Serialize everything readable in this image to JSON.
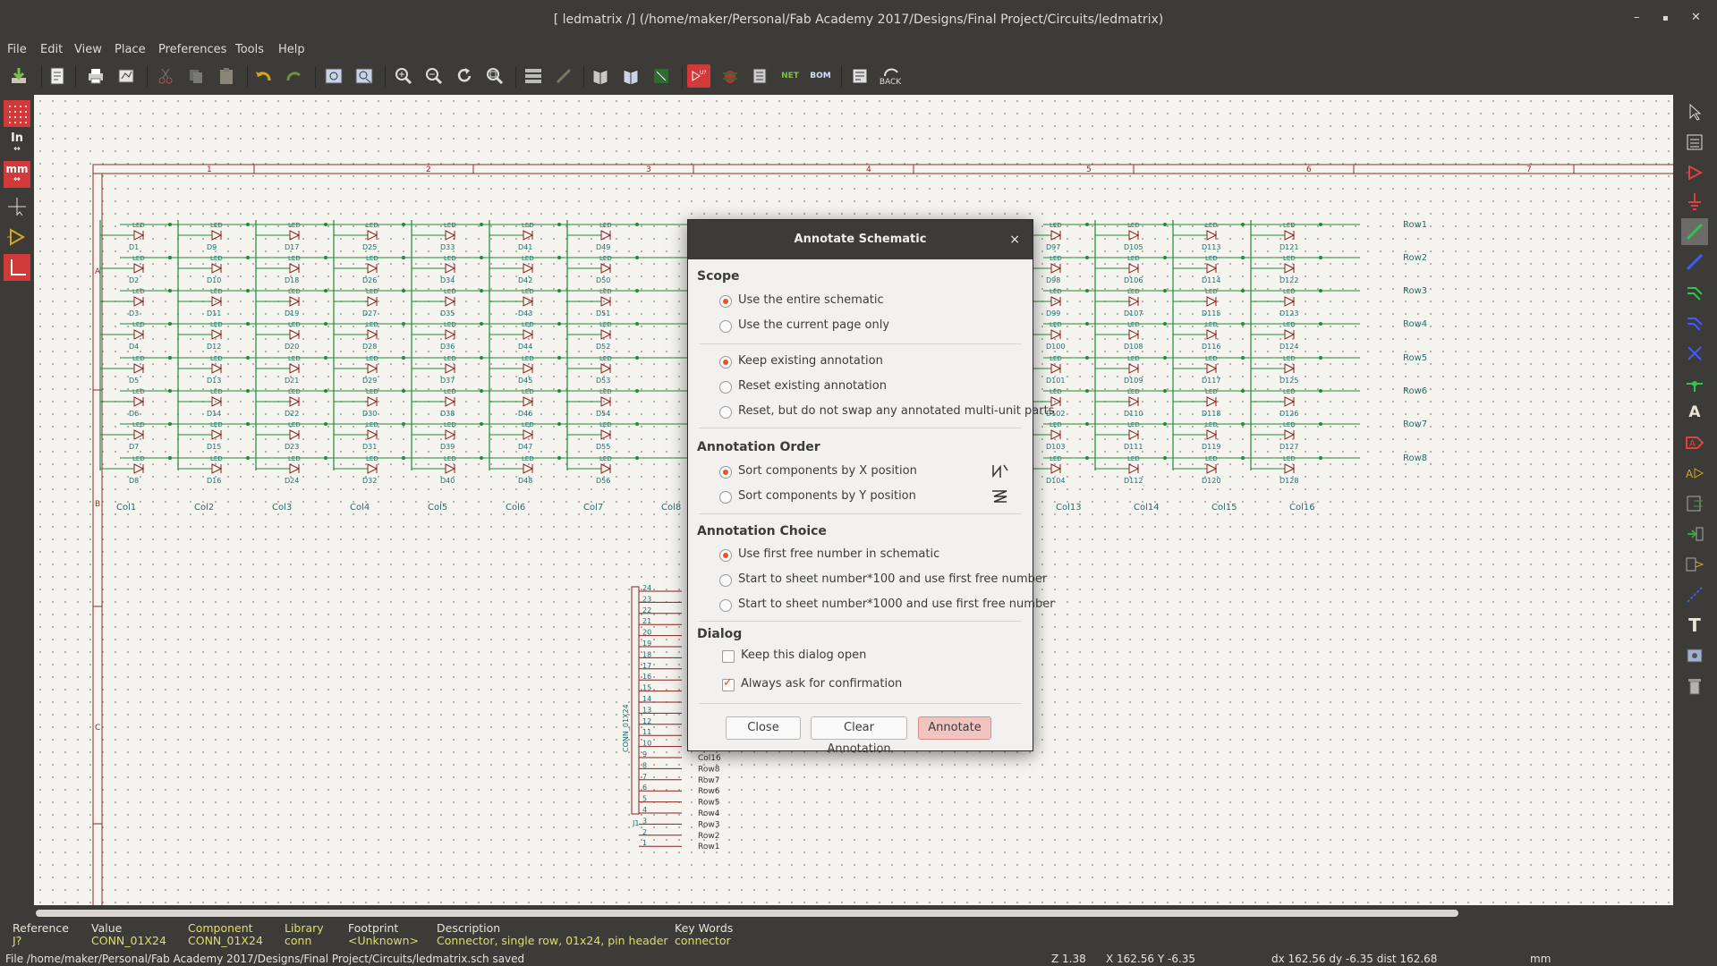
{
  "window": {
    "title": "[ ledmatrix /] (/home/maker/Personal/Fab Academy 2017/Designs/Final Project/Circuits/ledmatrix)",
    "minimize": "–",
    "maximize": "▪",
    "close": "✕"
  },
  "menu": [
    "File",
    "Edit",
    "View",
    "Place",
    "Preferences",
    "Tools",
    "Help"
  ],
  "toolbar": {
    "net_label": "NET",
    "bom_label": "BOM",
    "back_label": "BACK",
    "icons": [
      "save-icon",
      "page-settings-icon",
      "print-icon",
      "plot-icon",
      "cut-icon",
      "copy-icon",
      "paste-icon",
      "undo-icon",
      "redo-icon",
      "find-icon",
      "find-replace-icon",
      "zoom-in-icon",
      "zoom-out-icon",
      "redraw-icon",
      "zoom-fit-icon",
      "hierarchy-icon",
      "leave-sheet-icon",
      "library-editor-icon",
      "library-browser-icon",
      "module-editor-icon",
      "annotate-icon",
      "erc-icon",
      "cvpcb-icon",
      "netlist-icon",
      "bom-icon",
      "pcbnew-icon",
      "back-import-icon"
    ]
  },
  "left_toolbar": {
    "units_in": "In",
    "units_mm": "mm"
  },
  "schematic": {
    "zone_numbers": [
      "1",
      "2",
      "3",
      "4",
      "5",
      "6",
      "7"
    ],
    "zone_letters": [
      "A",
      "B",
      "C"
    ],
    "row_labels": [
      "Row1",
      "Row2",
      "Row3",
      "Row4",
      "Row5",
      "Row6",
      "Row7",
      "Row8"
    ],
    "col_labels_left": [
      "Col1",
      "Col2",
      "Col3",
      "Col4",
      "Col5",
      "Col6",
      "Col7",
      "Col8"
    ],
    "col_labels_right": [
      "Col13",
      "Col14",
      "Col15",
      "Col16"
    ],
    "led_columns_left": [
      [
        "D1",
        "D2",
        "D3",
        "D4",
        "D5",
        "D6",
        "D7",
        "D8"
      ],
      [
        "D9",
        "D10",
        "D11",
        "D12",
        "D13",
        "D14",
        "D15",
        "D16"
      ],
      [
        "D17",
        "D18",
        "D19",
        "D20",
        "D21",
        "D22",
        "D23",
        "D24"
      ],
      [
        "D25",
        "D26",
        "D27",
        "D28",
        "D29",
        "D30",
        "D31",
        "D32"
      ],
      [
        "D33",
        "D34",
        "D35",
        "D36",
        "D37",
        "D38",
        "D39",
        "D40"
      ],
      [
        "D41",
        "D42",
        "D43",
        "D44",
        "D45",
        "D46",
        "D47",
        "D48"
      ],
      [
        "D49",
        "D50",
        "D51",
        "D52",
        "D53",
        "D54",
        "D55",
        "D56"
      ]
    ],
    "led_columns_right": [
      [
        "D97",
        "D98",
        "D99",
        "D100",
        "D101",
        "D102",
        "D103",
        "D104"
      ],
      [
        "D105",
        "D106",
        "D107",
        "D108",
        "D109",
        "D110",
        "D111",
        "D112"
      ],
      [
        "D113",
        "D114",
        "D115",
        "D116",
        "D117",
        "D118",
        "D119",
        "D120"
      ],
      [
        "D121",
        "D122",
        "D123",
        "D124",
        "D125",
        "D126",
        "D127",
        "D128"
      ]
    ],
    "led_value": "LED",
    "connector_ref": "J1",
    "connector_value": "CONN_01X24",
    "pin_numbers": [
      "24",
      "23",
      "22",
      "21",
      "20",
      "19",
      "18",
      "17",
      "16",
      "15",
      "14",
      "13",
      "12",
      "11",
      "10",
      "9",
      "8",
      "7",
      "6",
      "5",
      "4",
      "3",
      "2",
      "1"
    ],
    "pin_labels": [
      "Col16",
      "Row8",
      "Row7",
      "Row6",
      "Row5",
      "Row4",
      "Row3",
      "Row2",
      "Row1"
    ]
  },
  "dialog": {
    "title": "Annotate Schematic",
    "close_glyph": "×",
    "scope_heading": "Scope",
    "scope_options": [
      "Use the entire schematic",
      "Use the current page only"
    ],
    "existing_options": [
      "Keep existing annotation",
      "Reset existing annotation",
      "Reset, but do not swap any annotated multi-unit parts"
    ],
    "order_heading": "Annotation Order",
    "order_options": [
      "Sort components by X position",
      "Sort components by Y position"
    ],
    "choice_heading": "Annotation Choice",
    "choice_options": [
      "Use first free number in schematic",
      "Start to  sheet number*100 and use first free number",
      "Start to  sheet number*1000 and use first free number"
    ],
    "dialog_heading": "Dialog",
    "dialog_options": [
      "Keep this dialog open",
      "Always ask for confirmation"
    ],
    "buttons": {
      "close": "Close",
      "clear": "Clear Annotation",
      "annotate": "Annotate"
    }
  },
  "message_panel": {
    "reference": {
      "label": "Reference",
      "value": "J?"
    },
    "value": {
      "label": "Value",
      "value": "CONN_01X24"
    },
    "component": {
      "label": "Component",
      "value": "CONN_01X24"
    },
    "library": {
      "label": "Library",
      "value": "conn"
    },
    "footprint": {
      "label": "Footprint",
      "value": "<Unknown>"
    },
    "description": {
      "label": "Description",
      "value": "Connector, single row, 01x24, pin header"
    },
    "keywords": {
      "label": "Key Words",
      "value": "connector"
    }
  },
  "status": {
    "message": "File /home/maker/Personal/Fab Academy 2017/Designs/Final Project/Circuits/ledmatrix.sch saved",
    "zoom": "Z 1.38",
    "coords": "X 162.56  Y -6.35",
    "delta": "dx 162.56  dy -6.35  dist 162.68",
    "units": "mm"
  },
  "colors": {
    "sheet_border": "#8c2b2b",
    "wire": "#1f8a3a",
    "component": "#8a1f1f",
    "text": "#1e6f6f",
    "accent": "#e95420"
  }
}
